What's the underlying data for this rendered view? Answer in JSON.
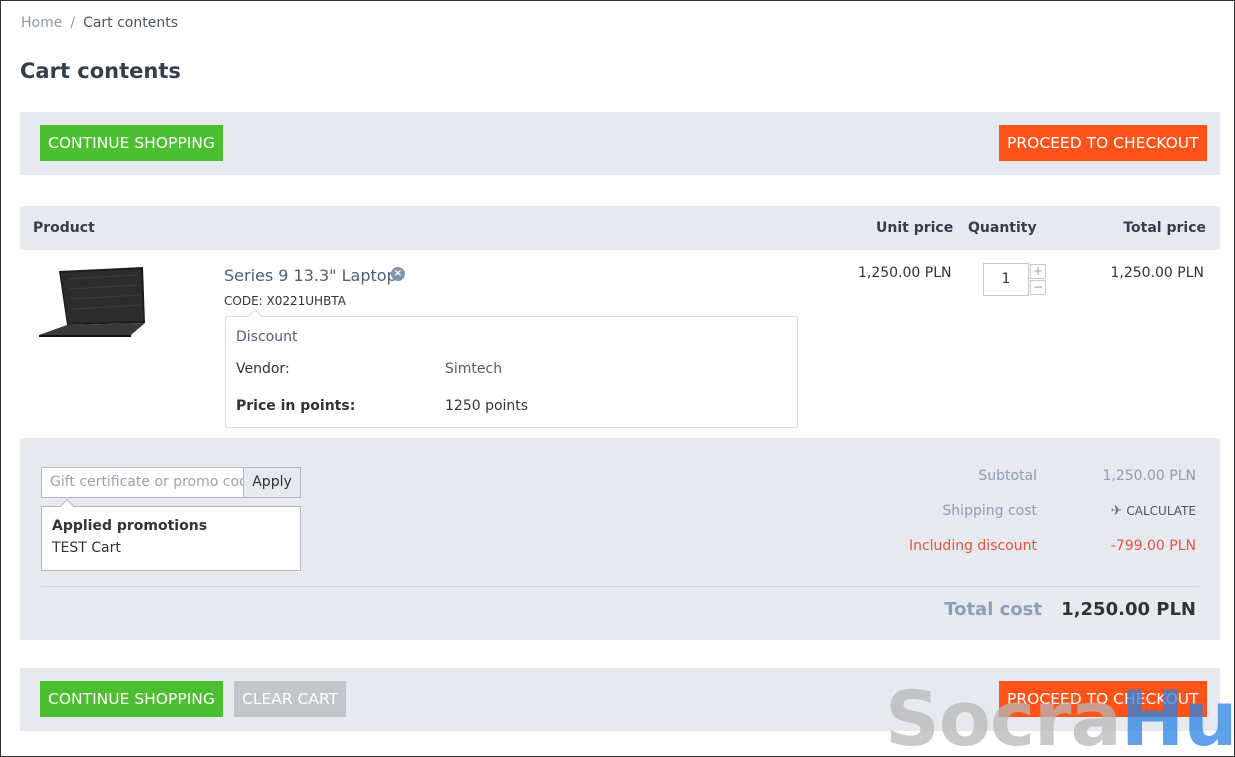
{
  "breadcrumb": {
    "home": "Home",
    "separator": "/",
    "current": "Cart contents"
  },
  "page": {
    "title": "Cart contents"
  },
  "top_bar": {
    "continue_label": "CONTINUE SHOPPING",
    "checkout_label": "PROCEED TO CHECKOUT"
  },
  "table": {
    "headers": {
      "product": "Product",
      "unit_price": "Unit price",
      "quantity": "Quantity",
      "total_price": "Total price"
    }
  },
  "item": {
    "name": "Series 9 13.3\" Laptop",
    "code": "CODE: X0221UHBTA",
    "options": {
      "discount_label": "Discount",
      "vendor_label": "Vendor:",
      "vendor_value": "Simtech",
      "points_label": "Price in points:",
      "points_value": "1250 points"
    },
    "unit_price": "1,250.00 PLN",
    "quantity": "1",
    "total_price": "1,250.00 PLN"
  },
  "promo": {
    "placeholder": "Gift certificate or promo code",
    "apply_label": "Apply",
    "applied_title": "Applied promotions",
    "applied_item": "TEST Cart"
  },
  "summary": {
    "subtotal_label": "Subtotal",
    "subtotal_value": "1,250.00 PLN",
    "shipping_label": "Shipping cost",
    "shipping_value": "CALCULATE",
    "discount_label": "Including discount",
    "discount_value": "-799.00 PLN",
    "total_label": "Total cost",
    "total_value": "1,250.00 PLN"
  },
  "bottom_bar": {
    "continue_label": "CONTINUE SHOPPING",
    "clear_label": "CLEAR CART",
    "checkout_label": "PROCEED TO CHECKOUT"
  },
  "watermark": {
    "part1": "Socra",
    "part2": "Hub"
  },
  "colors": {
    "green": "#4bbf2f",
    "orange": "#ff5319",
    "gray_button": "#c2c5ca",
    "discount_red": "#e8543a",
    "bar_bg": "#e6e9ef"
  }
}
